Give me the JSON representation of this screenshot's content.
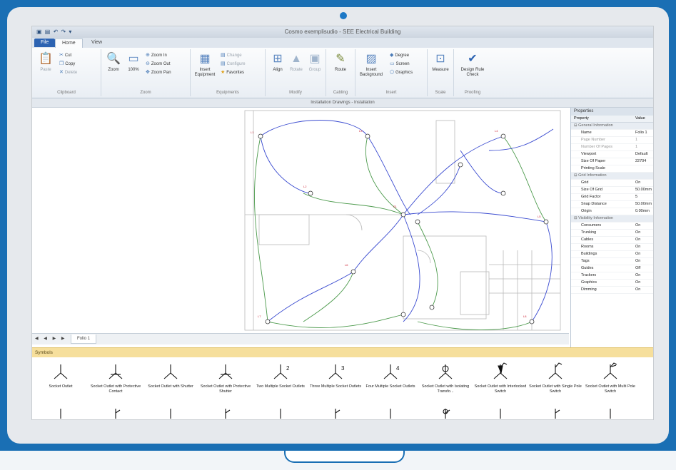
{
  "app": {
    "quick_access": "▣ ▤ ↶ ↷ ▾",
    "window_title": "Cosmo exemplisudio - SEE Electrical Building"
  },
  "tabs": {
    "file": "File",
    "home": "Home",
    "view": "View"
  },
  "ribbon": {
    "clipboard": {
      "label": "Clipboard",
      "paste": "Paste",
      "cut": "Cut",
      "copy": "Copy",
      "delete": "Delete"
    },
    "zoom": {
      "label": "Zoom",
      "zoom": "Zoom",
      "hundred": "100%",
      "zoom_in": "Zoom In",
      "zoom_out": "Zoom Out",
      "zoom_pan": "Zoom Pan"
    },
    "equipments": {
      "label": "Equipments",
      "insert": "Insert Equipment",
      "change": "Change",
      "configure": "Configure",
      "favorites": "Favorites"
    },
    "modify": {
      "label": "Modify",
      "align": "Align",
      "rotate": "Rotate",
      "group": "Group"
    },
    "cabling": {
      "label": "Cabling",
      "route": "Route"
    },
    "insert": {
      "label": "Insert",
      "background": "Insert Background",
      "degree": "Degree",
      "screen": "Screen",
      "graphics": "Graphics"
    },
    "scale": {
      "label": "Scale",
      "measure": "Measure"
    },
    "proofing": {
      "label": "Proofing",
      "design_check": "Design Rule Check"
    }
  },
  "document_tab": "Installation Drawings - Installation",
  "sheet_nav": "◀ ◀ ▶ ▶",
  "sheet_tab": "Folio 1",
  "properties": {
    "header": "Properties",
    "col_property": "Property",
    "col_value": "Value",
    "rows": [
      {
        "key": "General Information",
        "value": "",
        "cat": true
      },
      {
        "key": "Name",
        "value": "Folio 1"
      },
      {
        "key": "Page Number",
        "value": "1",
        "muted": true
      },
      {
        "key": "Number Of Pages",
        "value": "1",
        "muted": true
      },
      {
        "key": "Viewport",
        "value": "Default"
      },
      {
        "key": "Size Of Paper",
        "value": "22704"
      },
      {
        "key": "Printing Scale",
        "value": ""
      },
      {
        "key": "Grid Information",
        "value": "",
        "cat": true
      },
      {
        "key": "Grid",
        "value": "On"
      },
      {
        "key": "Size Of Grid",
        "value": "50.00mm"
      },
      {
        "key": "Grid Factor",
        "value": "5"
      },
      {
        "key": "Snap Distance",
        "value": "50.00mm"
      },
      {
        "key": "Origin",
        "value": "0.00mm"
      },
      {
        "key": "Visibility Information",
        "value": "",
        "cat": true
      },
      {
        "key": "Consumers",
        "value": "On"
      },
      {
        "key": "Trunking",
        "value": "On"
      },
      {
        "key": "Cables",
        "value": "On"
      },
      {
        "key": "Rooms",
        "value": "On"
      },
      {
        "key": "Buildings",
        "value": "On"
      },
      {
        "key": "Tags",
        "value": "On"
      },
      {
        "key": "Guides",
        "value": "Off"
      },
      {
        "key": "Trackers",
        "value": "On"
      },
      {
        "key": "Graphics",
        "value": "On"
      },
      {
        "key": "Dimming",
        "value": "On"
      }
    ]
  },
  "symbols_header": "Symbols",
  "symbols": [
    {
      "label": "Socket Outlet",
      "icon": "socket-outlet-icon"
    },
    {
      "label": "Socket Outlet with Protective Contact",
      "icon": "socket-protective-icon"
    },
    {
      "label": "Socket Outlet with Shutter",
      "icon": "socket-shutter-icon"
    },
    {
      "label": "Socket Outlet with Protective Shutter",
      "icon": "socket-protective-shutter-icon"
    },
    {
      "label": "Two Multiple Socket Outlets",
      "icon": "socket-two-icon",
      "mult": "2"
    },
    {
      "label": "Three Multiple Socket Outlets",
      "icon": "socket-three-icon",
      "mult": "3"
    },
    {
      "label": "Four Multiple Socket Outlets",
      "icon": "socket-four-icon",
      "mult": "4"
    },
    {
      "label": "Socket Outlet with Isolating Transfo...",
      "icon": "socket-transformer-icon"
    },
    {
      "label": "Socket Outlet with Interlocked Switch",
      "icon": "socket-interlocked-icon"
    },
    {
      "label": "Socket Outlet with Single Pole Switch",
      "icon": "socket-single-pole-icon"
    },
    {
      "label": "Socket Outlet with Multi Pole Switch",
      "icon": "socket-multi-pole-icon"
    }
  ]
}
